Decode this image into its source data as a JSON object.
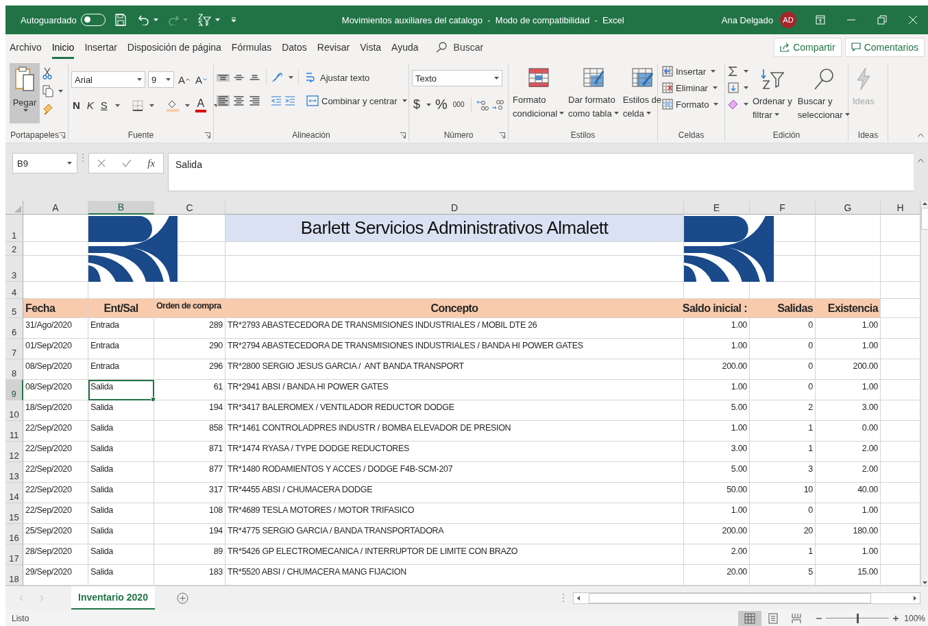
{
  "title_bar": {
    "autosave_label": "Autoguardado",
    "autosave_on": false,
    "title": "Movimientos auxiliares del catalogo  -  Modo de compatibilidad  -  Excel",
    "user_name": "Ana Delgado",
    "user_initials": "AD"
  },
  "menu_tabs": [
    {
      "label": "Archivo",
      "selected": false
    },
    {
      "label": "Inicio",
      "selected": true
    },
    {
      "label": "Insertar",
      "selected": false
    },
    {
      "label": "Disposición de página",
      "selected": false
    },
    {
      "label": "Fórmulas",
      "selected": false
    },
    {
      "label": "Datos",
      "selected": false
    },
    {
      "label": "Revisar",
      "selected": false
    },
    {
      "label": "Vista",
      "selected": false
    },
    {
      "label": "Ayuda",
      "selected": false
    }
  ],
  "search_label": "Buscar",
  "share_button": "Compartir",
  "comments_button": "Comentarios",
  "ribbon": {
    "clipboard": {
      "paste": "Pegar",
      "label": "Portapapeles"
    },
    "font": {
      "name": "Arial",
      "size": "9",
      "grow": "A",
      "shrink": "A",
      "bold": "N",
      "italic": "K",
      "underline": "S",
      "color_button": "A",
      "label": "Fuente"
    },
    "alignment": {
      "vertical": [
        {
          "kind": "top",
          "selected": true
        },
        {
          "kind": "middle",
          "selected": false
        },
        {
          "kind": "bottom",
          "selected": false
        }
      ],
      "horizontal": [
        {
          "kind": "left",
          "selected": true
        },
        {
          "kind": "center",
          "selected": false
        },
        {
          "kind": "right",
          "selected": false
        }
      ],
      "wrap": "Ajustar texto",
      "merge": "Combinar y centrar",
      "label": "Alineación"
    },
    "number": {
      "format": "Texto",
      "currency": "$",
      "percent": "%",
      "thousands": "000",
      "label": "Número"
    },
    "styles": {
      "items": [
        {
          "kind": "conditional",
          "lines": [
            "Formato",
            "condicional"
          ]
        },
        {
          "kind": "table",
          "lines": [
            "Dar formato",
            "como tabla"
          ]
        },
        {
          "kind": "cell",
          "lines": [
            "Estilos de",
            "celda"
          ]
        }
      ],
      "label": "Estilos"
    },
    "cells": {
      "items": [
        {
          "kind": "insert",
          "label": "Insertar"
        },
        {
          "kind": "delete",
          "label": "Eliminar"
        },
        {
          "kind": "format",
          "label": "Formato"
        }
      ],
      "label": "Celdas"
    },
    "editing": {
      "items": [
        {
          "kind": "sort",
          "lines": [
            "Ordenar y",
            "filtrar"
          ]
        },
        {
          "kind": "find",
          "lines": [
            "Buscar y",
            "seleccionar"
          ]
        }
      ],
      "label": "Edición"
    },
    "ideas": {
      "button": "Ideas",
      "disabled": true,
      "label": "Ideas"
    }
  },
  "formula_bar": {
    "name_box": "B9",
    "function_symbol": "fx",
    "formula": "Salida"
  },
  "sheet": {
    "columns": [
      {
        "label": "A",
        "kind": "text",
        "selected": false
      },
      {
        "label": "B",
        "kind": "text",
        "selected": true
      },
      {
        "label": "C",
        "kind": "number",
        "selected": false
      },
      {
        "label": "D",
        "kind": "text",
        "selected": false
      },
      {
        "label": "E",
        "kind": "number",
        "selected": false
      },
      {
        "label": "F",
        "kind": "number",
        "selected": false
      },
      {
        "label": "G",
        "kind": "number",
        "selected": false
      },
      {
        "label": "H",
        "kind": "text",
        "selected": false
      }
    ],
    "top_rows": [
      "1",
      "2",
      "3",
      "4"
    ],
    "title": "Barlett Servicios Administrativos Almalett",
    "header_row": "5",
    "headers": [
      "Fecha",
      "Ent/Sal",
      "Orden de compra",
      "Concepto",
      "Saldo inicial :",
      "Salidas",
      "Existencia"
    ],
    "rows": [
      {
        "number": "6",
        "selected": false,
        "cells": [
          "31/Ago/2020",
          "Entrada",
          "289",
          "TR*2793 ABASTECEDORA DE TRANSMISIONES INDUSTRIALES / MOBIL DTE 26",
          "1.00",
          "0",
          "1.00"
        ]
      },
      {
        "number": "7",
        "selected": false,
        "cells": [
          "01/Sep/2020",
          "Entrada",
          "290",
          "TR*2794 ABASTECEDORA DE TRANSMISIONES INDUSTRIALES / BANDA HI POWER GATES",
          "1.00",
          "0",
          "1.00"
        ]
      },
      {
        "number": "8",
        "selected": false,
        "cells": [
          "08/Sep/2020",
          "Entrada",
          "296",
          "TR*2800 SERGIO JESUS GARCIA /  ANT BANDA TRANSPORT",
          "200.00",
          "0",
          "200.00"
        ]
      },
      {
        "number": "9",
        "selected": true,
        "cells": [
          "08/Sep/2020",
          "Salida",
          "61",
          "TR*2941 ABSI / BANDA HI POWER GATES",
          "1.00",
          "0",
          "1.00"
        ]
      },
      {
        "number": "10",
        "selected": false,
        "cells": [
          "18/Sep/2020",
          "Salida",
          "194",
          "TR*3417 BALEROMEX / VENTILADOR REDUCTOR DODGE",
          "5.00",
          "2",
          "3.00"
        ]
      },
      {
        "number": "11",
        "selected": false,
        "cells": [
          "22/Sep/2020",
          "Salida",
          "858",
          "TR*1461 CONTROLADPRES INDUSTR / BOMBA ELEVADOR DE PRESION",
          "1.00",
          "1",
          "0.00"
        ]
      },
      {
        "number": "12",
        "selected": false,
        "cells": [
          "22/Sep/2020",
          "Salida",
          "871",
          "TR*1474 RYASA / TYPE DODGE REDUCTORES",
          "3.00",
          "1",
          "2.00"
        ]
      },
      {
        "number": "13",
        "selected": false,
        "cells": [
          "22/Sep/2020",
          "Salida",
          "877",
          "TR*1480 RODAMIENTOS Y ACCES / DODGE F4B-SCM-207",
          "5.00",
          "3",
          "2.00"
        ]
      },
      {
        "number": "14",
        "selected": false,
        "cells": [
          "22/Sep/2020",
          "Salida",
          "317",
          "TR*4455 ABSI / CHUMACERA DODGE",
          "50.00",
          "10",
          "40.00"
        ]
      },
      {
        "number": "15",
        "selected": false,
        "cells": [
          "22/Sep/2020",
          "Salida",
          "108",
          "TR*4689 TESLA MOTORES / MOTOR TRIFASICO",
          "1.00",
          "0",
          "1.00"
        ]
      },
      {
        "number": "16",
        "selected": false,
        "cells": [
          "25/Sep/2020",
          "Salida",
          "194",
          "TR*4775 SERGIO GARCIA / BANDA TRANSPORTADORA",
          "200.00",
          "20",
          "180.00"
        ]
      },
      {
        "number": "17",
        "selected": false,
        "cells": [
          "28/Sep/2020",
          "Salida",
          "89",
          "TR*5426 GP ELECTROMECANICA / INTERRUPTOR DE LIMITE CON BRAZO",
          "2.00",
          "1",
          "1.00"
        ]
      },
      {
        "number": "18",
        "selected": false,
        "cells": [
          "29/Sep/2020",
          "Salida",
          "183",
          "TR*5520 ABSI / CHUMACERA MANG FIJACION",
          "20.00",
          "5",
          "15.00"
        ]
      }
    ]
  },
  "sheet_tabs": [
    {
      "label": "Inventario 2020",
      "selected": true
    }
  ],
  "status_bar": {
    "status": "Listo",
    "views": [
      {
        "kind": "normal",
        "selected": true
      },
      {
        "kind": "page_layout",
        "selected": false
      },
      {
        "kind": "page_break",
        "selected": false
      }
    ],
    "zoom_slider": {
      "level": 0.5
    },
    "zoom": "100%"
  }
}
